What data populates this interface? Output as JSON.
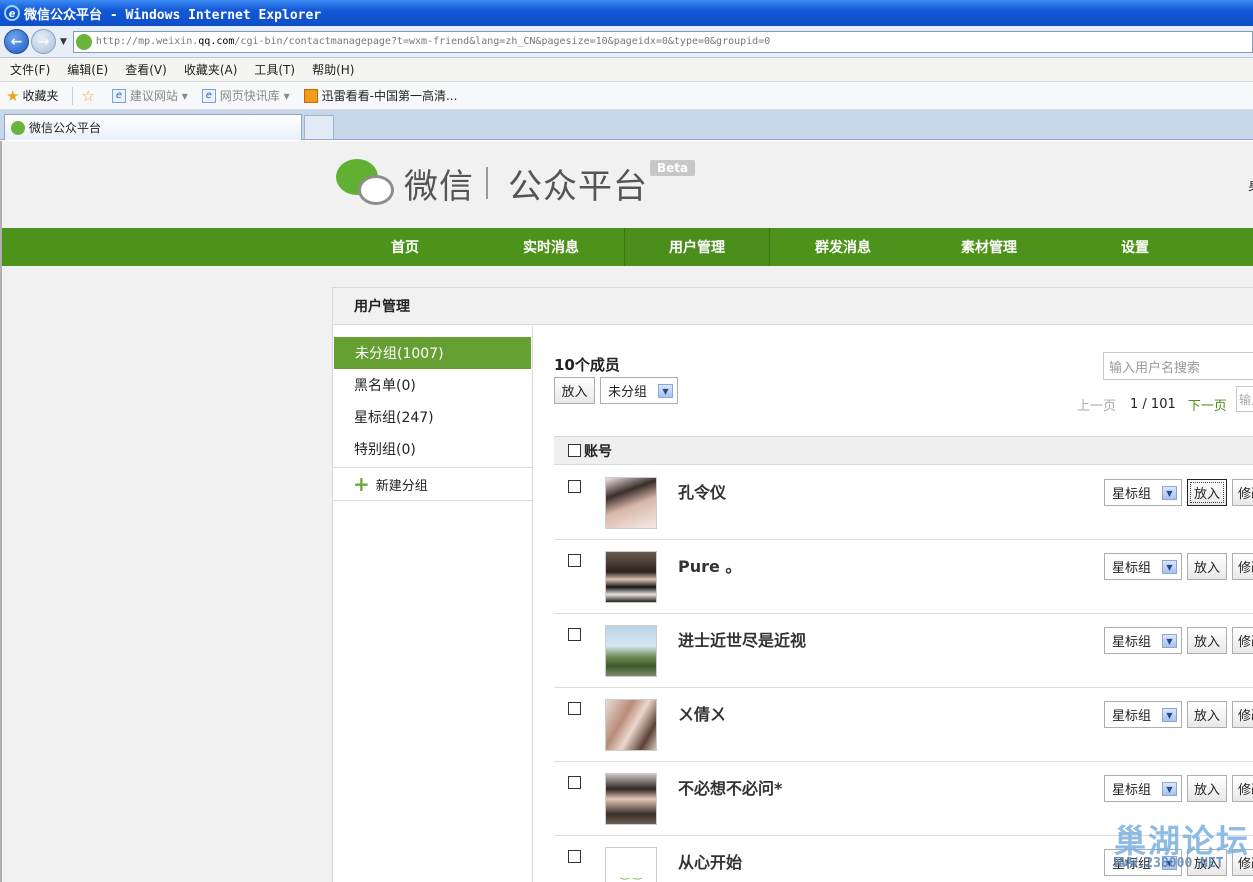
{
  "window": {
    "title": "微信公众平台 - Windows Internet Explorer",
    "url_prefix": "http://mp.weixin.",
    "url_host": "qq.com",
    "url_rest": "/cgi-bin/contactmanagepage?t=wxm-friend&lang=zh_CN&pagesize=10&pageidx=0&type=0&groupid=0"
  },
  "menubar": [
    "文件(F)",
    "编辑(E)",
    "查看(V)",
    "收藏夹(A)",
    "工具(T)",
    "帮助(H)"
  ],
  "favorites": {
    "label": "收藏夹",
    "items": [
      "建议网站 ▾",
      "网页快讯库 ▾",
      "迅雷看看-中国第一高清..."
    ]
  },
  "tab": {
    "title": "微信公众平台"
  },
  "header": {
    "logo_name": "微信",
    "logo_sub": "公众平台",
    "beta": "Beta",
    "right_glyph": "身"
  },
  "nav": [
    "首页",
    "实时消息",
    "用户管理",
    "群发消息",
    "素材管理",
    "设置"
  ],
  "panel": {
    "title": "用户管理"
  },
  "groups": [
    {
      "label": "未分组(1007)"
    },
    {
      "label": "黑名单(0)"
    },
    {
      "label": "星标组(247)"
    },
    {
      "label": "特别组(0)"
    }
  ],
  "new_group": "新建分组",
  "main": {
    "member_count": "10个成员",
    "search_placeholder": "输入用户名搜索",
    "put_label": "放入",
    "group_select": "未分组",
    "pager": {
      "prev": "上一页",
      "info": "1 / 101",
      "next": "下一页",
      "input": "输入"
    },
    "column_account": "账号"
  },
  "rows": [
    {
      "name": "孔令仪",
      "group": "星标组",
      "put": "放入",
      "edit": "修改"
    },
    {
      "name": "Pure 。",
      "group": "星标组",
      "put": "放入",
      "edit": "修改"
    },
    {
      "name": "进士近世尽是近视",
      "group": "星标组",
      "put": "放入",
      "edit": "修改"
    },
    {
      "name": "ㄨ倩ㄨ",
      "group": "星标组",
      "put": "放入",
      "edit": "修改"
    },
    {
      "name": "不必想不必问*",
      "group": "星标组",
      "put": "放入",
      "edit": "修改"
    },
    {
      "name": "从心开始",
      "group": "星标组",
      "put": "放入",
      "edit": "修改"
    }
  ],
  "watermark": {
    "cn": "巢湖论坛",
    "en": "WWW.238000.NET"
  },
  "colors": {
    "nav_green": "#4d921a",
    "active_group": "#66a033",
    "ie_blue": "#1458d6"
  }
}
